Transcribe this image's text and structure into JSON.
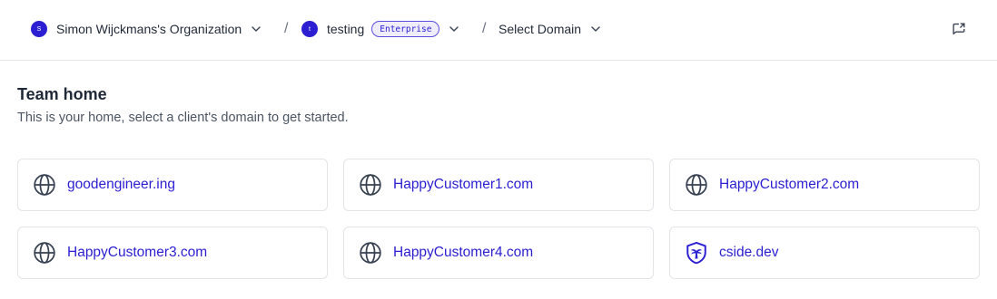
{
  "breadcrumb": {
    "org": {
      "name": "Simon Wijckmans's Organization",
      "avatar_letter": "S"
    },
    "separator": "/",
    "project": {
      "name": "testing",
      "avatar_letter": "t",
      "plan_badge": "Enterprise"
    },
    "domain_select": {
      "label": "Select Domain"
    }
  },
  "page": {
    "title": "Team home",
    "subtitle": "This is your home, select a client's domain to get started."
  },
  "domains": [
    {
      "label": "goodengineer.ing",
      "icon": "globe-icon"
    },
    {
      "label": "HappyCustomer1.com",
      "icon": "globe-icon"
    },
    {
      "label": "HappyCustomer2.com",
      "icon": "globe-icon"
    },
    {
      "label": "HappyCustomer3.com",
      "icon": "globe-icon"
    },
    {
      "label": "HappyCustomer4.com",
      "icon": "globe-icon"
    },
    {
      "label": "cside.dev",
      "icon": "cside-shield-icon"
    }
  ],
  "colors": {
    "accent": "#2b1fd1",
    "badge_bg": "#eeecfd",
    "border": "#e2e4e8",
    "text": "#1f2937",
    "muted": "#4b5563"
  }
}
